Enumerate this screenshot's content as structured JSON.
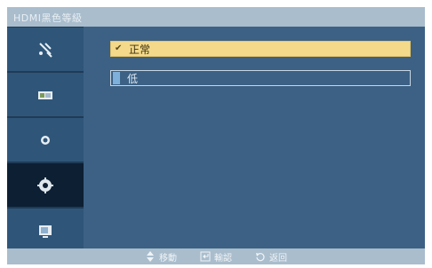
{
  "window": {
    "title": "HDMI黑色等級"
  },
  "sidebar": {
    "items": [
      {
        "icon": "input-antenna-icon",
        "selected": false
      },
      {
        "icon": "picture-icon",
        "selected": false
      },
      {
        "icon": "sound-icon",
        "selected": false
      },
      {
        "icon": "setup-gear-icon",
        "selected": true
      },
      {
        "icon": "multi-control-icon",
        "selected": false
      }
    ]
  },
  "options": {
    "items": [
      {
        "label": "正常",
        "checked": true,
        "highlighted": true
      },
      {
        "label": "低",
        "checked": false,
        "highlighted": false
      }
    ]
  },
  "footer": {
    "move_label": "移動",
    "enter_label": "輸認",
    "return_label": "返回"
  },
  "colors": {
    "panel_background": "#3c6185",
    "title_bar": "#a9bdcd",
    "sidebar_item": "#2f5679",
    "sidebar_selected": "#0d1f33",
    "highlight": "#f4d98a"
  }
}
